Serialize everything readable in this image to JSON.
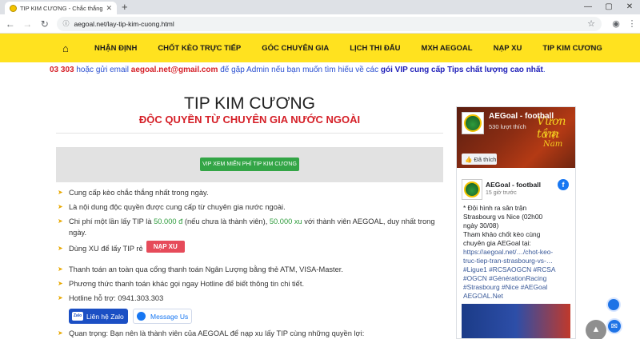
{
  "browser": {
    "tab_title": "TIP KIM CƯƠNG - Chắc thắng nhất",
    "tab_close": "✕",
    "new_tab": "+",
    "url": "aegoal.net/lay-tip-kim-cuong.html",
    "win_min": "—",
    "win_max": "▢",
    "win_close": "✕"
  },
  "nav": {
    "items": [
      "NHẬN ĐỊNH",
      "CHỐT KÈO TRỰC TIẾP",
      "GÓC CHUYÊN GIA",
      "LỊCH THI ĐẤU",
      "MXH AEGOAL",
      "NẠP XU",
      "TIP KIM CƯƠNG"
    ]
  },
  "marquee": {
    "phone": "03 303",
    "t1": " hoặc gửi email ",
    "email": "aegoal.net@gmail.com",
    "t2": " để gặp Admin nếu bạn muốn tìm hiểu về các ",
    "vip": "gói VIP cung cấp Tips chất lượng cao nhất",
    "t3": "."
  },
  "main": {
    "title": "TIP KIM CƯƠNG",
    "subtitle": "ĐỘC QUYỀN TỪ CHUYÊN GIA NƯỚC NGOÀI",
    "vip_button": "VIP XEM MIỄN PHÍ TIP KIM CƯƠNG",
    "bullets": {
      "b1": "Cung cấp kèo chắc thắng nhất trong ngày.",
      "b2": "Là nội dung độc quyền được cung cấp từ chuyên gia nước ngoài.",
      "b3_a": "Chi phí một lần lấy TIP là ",
      "b3_price": "50.000 đ",
      "b3_b": " (nếu chưa là thành viên), ",
      "b3_xu": "50.000 xu",
      "b3_c": " với thành viên AEGOAL, duy nhất trong",
      "b3_d": "ngày.",
      "b4": "Dùng XU để lấy TIP rẻ",
      "b4_btn": "NẠP XU",
      "b5": "Thanh toán an toàn qua cổng thanh toán Ngân Lượng bằng thẻ ATM, VISA-Master.",
      "b6": "Phương thức thanh toán khác gọi ngay Hotline để biết thông tin chi tiết.",
      "b7": "Hotline hỗ trợ: 0941.303.303",
      "b8": "Quan trọng: Bạn nên là thành viên của AEGOAL để nạp xu lấy TIP cùng những quyền lợi:"
    },
    "zalo_label": "Liên hệ Zalo",
    "zalo_icon": "Zalo",
    "messenger_label": "Message Us"
  },
  "fb": {
    "page_name": "AEGoal - football",
    "likes": "530 lượt thích",
    "like_btn": "Đã thích",
    "cover_text1": "Vươn tầm",
    "cover_text2": "Việt Nam",
    "post_name": "AEGoal - football",
    "post_time": "15 giờ trước",
    "body_lines": [
      "* Đội hình ra sân trận",
      "Strasbourg vs Nice (02h00",
      "ngày 30/08)",
      "Tham khảo chốt kèo cùng",
      "chuyên gia AEGoal tại:"
    ],
    "link_lines": [
      "https://aegoal.net/…/chot-keo-",
      "truc-tiep-tran-strasbourg-vs-…",
      "#Ligue1 #RCSAOGCN #RCSA",
      "#OGCN #GénérationRacing",
      "#Strasbourg #Nice #AEGoal",
      "AEGOAL.Net"
    ]
  }
}
